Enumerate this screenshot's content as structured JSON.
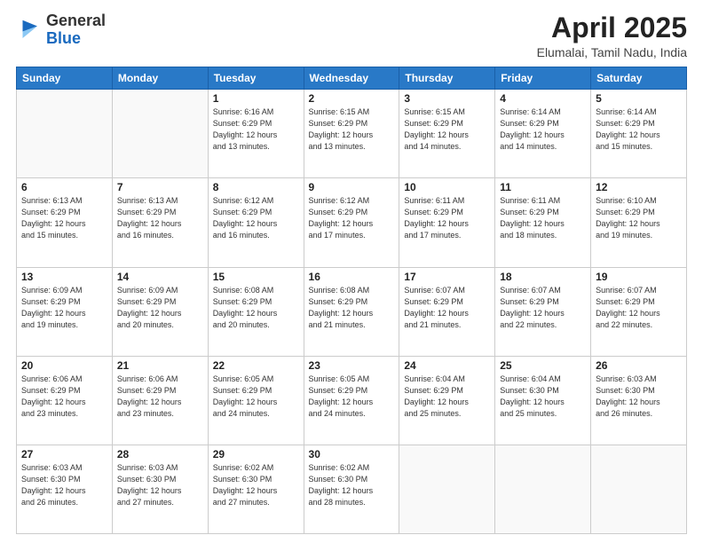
{
  "header": {
    "logo_general": "General",
    "logo_blue": "Blue",
    "title": "April 2025",
    "subtitle": "Elumalai, Tamil Nadu, India"
  },
  "days_of_week": [
    "Sunday",
    "Monday",
    "Tuesday",
    "Wednesday",
    "Thursday",
    "Friday",
    "Saturday"
  ],
  "weeks": [
    [
      {
        "day": "",
        "info": ""
      },
      {
        "day": "",
        "info": ""
      },
      {
        "day": "1",
        "info": "Sunrise: 6:16 AM\nSunset: 6:29 PM\nDaylight: 12 hours\nand 13 minutes."
      },
      {
        "day": "2",
        "info": "Sunrise: 6:15 AM\nSunset: 6:29 PM\nDaylight: 12 hours\nand 13 minutes."
      },
      {
        "day": "3",
        "info": "Sunrise: 6:15 AM\nSunset: 6:29 PM\nDaylight: 12 hours\nand 14 minutes."
      },
      {
        "day": "4",
        "info": "Sunrise: 6:14 AM\nSunset: 6:29 PM\nDaylight: 12 hours\nand 14 minutes."
      },
      {
        "day": "5",
        "info": "Sunrise: 6:14 AM\nSunset: 6:29 PM\nDaylight: 12 hours\nand 15 minutes."
      }
    ],
    [
      {
        "day": "6",
        "info": "Sunrise: 6:13 AM\nSunset: 6:29 PM\nDaylight: 12 hours\nand 15 minutes."
      },
      {
        "day": "7",
        "info": "Sunrise: 6:13 AM\nSunset: 6:29 PM\nDaylight: 12 hours\nand 16 minutes."
      },
      {
        "day": "8",
        "info": "Sunrise: 6:12 AM\nSunset: 6:29 PM\nDaylight: 12 hours\nand 16 minutes."
      },
      {
        "day": "9",
        "info": "Sunrise: 6:12 AM\nSunset: 6:29 PM\nDaylight: 12 hours\nand 17 minutes."
      },
      {
        "day": "10",
        "info": "Sunrise: 6:11 AM\nSunset: 6:29 PM\nDaylight: 12 hours\nand 17 minutes."
      },
      {
        "day": "11",
        "info": "Sunrise: 6:11 AM\nSunset: 6:29 PM\nDaylight: 12 hours\nand 18 minutes."
      },
      {
        "day": "12",
        "info": "Sunrise: 6:10 AM\nSunset: 6:29 PM\nDaylight: 12 hours\nand 19 minutes."
      }
    ],
    [
      {
        "day": "13",
        "info": "Sunrise: 6:09 AM\nSunset: 6:29 PM\nDaylight: 12 hours\nand 19 minutes."
      },
      {
        "day": "14",
        "info": "Sunrise: 6:09 AM\nSunset: 6:29 PM\nDaylight: 12 hours\nand 20 minutes."
      },
      {
        "day": "15",
        "info": "Sunrise: 6:08 AM\nSunset: 6:29 PM\nDaylight: 12 hours\nand 20 minutes."
      },
      {
        "day": "16",
        "info": "Sunrise: 6:08 AM\nSunset: 6:29 PM\nDaylight: 12 hours\nand 21 minutes."
      },
      {
        "day": "17",
        "info": "Sunrise: 6:07 AM\nSunset: 6:29 PM\nDaylight: 12 hours\nand 21 minutes."
      },
      {
        "day": "18",
        "info": "Sunrise: 6:07 AM\nSunset: 6:29 PM\nDaylight: 12 hours\nand 22 minutes."
      },
      {
        "day": "19",
        "info": "Sunrise: 6:07 AM\nSunset: 6:29 PM\nDaylight: 12 hours\nand 22 minutes."
      }
    ],
    [
      {
        "day": "20",
        "info": "Sunrise: 6:06 AM\nSunset: 6:29 PM\nDaylight: 12 hours\nand 23 minutes."
      },
      {
        "day": "21",
        "info": "Sunrise: 6:06 AM\nSunset: 6:29 PM\nDaylight: 12 hours\nand 23 minutes."
      },
      {
        "day": "22",
        "info": "Sunrise: 6:05 AM\nSunset: 6:29 PM\nDaylight: 12 hours\nand 24 minutes."
      },
      {
        "day": "23",
        "info": "Sunrise: 6:05 AM\nSunset: 6:29 PM\nDaylight: 12 hours\nand 24 minutes."
      },
      {
        "day": "24",
        "info": "Sunrise: 6:04 AM\nSunset: 6:29 PM\nDaylight: 12 hours\nand 25 minutes."
      },
      {
        "day": "25",
        "info": "Sunrise: 6:04 AM\nSunset: 6:30 PM\nDaylight: 12 hours\nand 25 minutes."
      },
      {
        "day": "26",
        "info": "Sunrise: 6:03 AM\nSunset: 6:30 PM\nDaylight: 12 hours\nand 26 minutes."
      }
    ],
    [
      {
        "day": "27",
        "info": "Sunrise: 6:03 AM\nSunset: 6:30 PM\nDaylight: 12 hours\nand 26 minutes."
      },
      {
        "day": "28",
        "info": "Sunrise: 6:03 AM\nSunset: 6:30 PM\nDaylight: 12 hours\nand 27 minutes."
      },
      {
        "day": "29",
        "info": "Sunrise: 6:02 AM\nSunset: 6:30 PM\nDaylight: 12 hours\nand 27 minutes."
      },
      {
        "day": "30",
        "info": "Sunrise: 6:02 AM\nSunset: 6:30 PM\nDaylight: 12 hours\nand 28 minutes."
      },
      {
        "day": "",
        "info": ""
      },
      {
        "day": "",
        "info": ""
      },
      {
        "day": "",
        "info": ""
      }
    ]
  ]
}
